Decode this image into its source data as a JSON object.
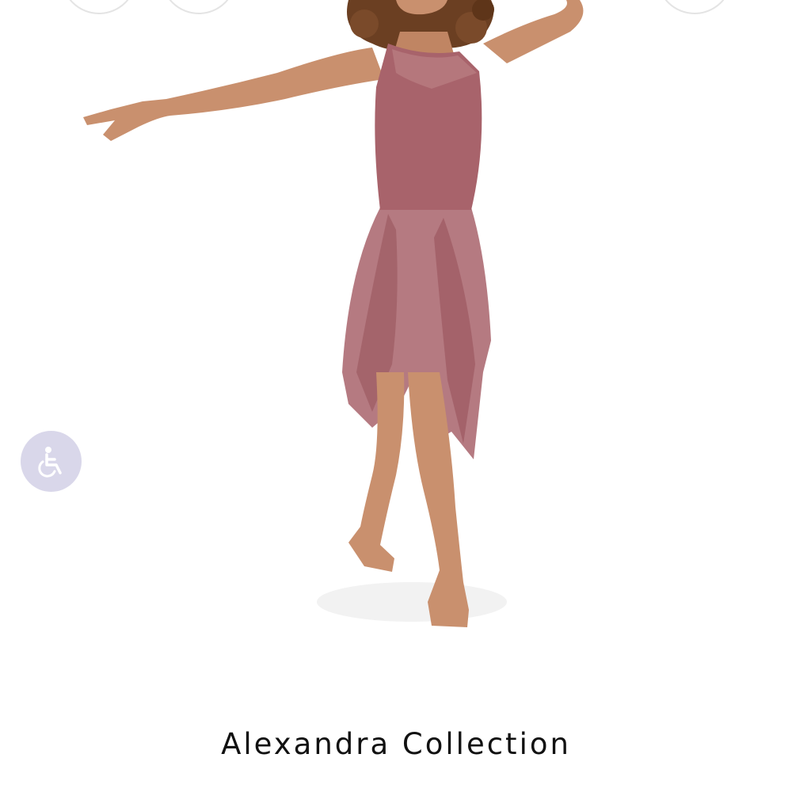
{
  "collection": {
    "title": "Alexandra Collection"
  },
  "accessibility": {
    "icon": "wheelchair-icon",
    "color": "#d9d7ea"
  },
  "product": {
    "dress_color": "#a8636b",
    "skin_color": "#c9906e",
    "hair_color": "#6b3f22"
  }
}
